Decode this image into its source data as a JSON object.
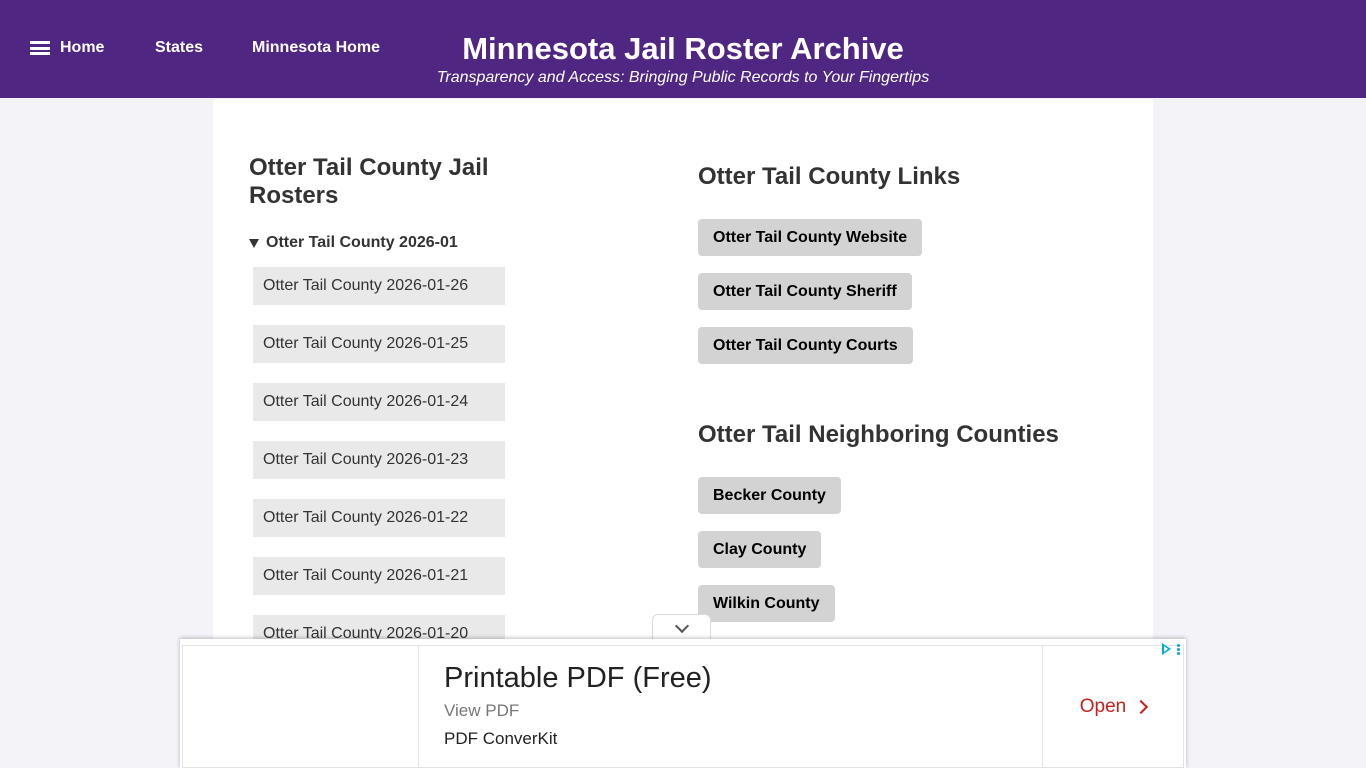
{
  "nav": {
    "home_label": "Home",
    "states_label": "States",
    "state_home_label": "Minnesota Home"
  },
  "header": {
    "title": "Minnesota Jail Roster Archive",
    "subtitle": "Transparency and Access: Bringing Public Records to Your Fingertips"
  },
  "rosters": {
    "title": "Otter Tail County Jail Rosters",
    "group_label": "Otter Tail County 2026-01",
    "items": [
      "Otter Tail County 2026-01-26",
      "Otter Tail County 2026-01-25",
      "Otter Tail County 2026-01-24",
      "Otter Tail County 2026-01-23",
      "Otter Tail County 2026-01-22",
      "Otter Tail County 2026-01-21",
      "Otter Tail County 2026-01-20"
    ]
  },
  "links": {
    "title": "Otter Tail County Links",
    "items": [
      "Otter Tail County Website",
      "Otter Tail County Sheriff",
      "Otter Tail County Courts"
    ]
  },
  "neighbors": {
    "title": "Otter Tail Neighboring Counties",
    "items": [
      "Becker County",
      "Clay County",
      "Wilkin County"
    ]
  },
  "ad": {
    "headline": "Printable PDF (Free)",
    "sub": "View PDF",
    "brand": "PDF ConverKit",
    "cta": "Open"
  },
  "colors": {
    "header_bg": "#502683",
    "button_bg": "#d3d3d3",
    "list_item_bg": "#e9e9e9",
    "cta": "#c5221f",
    "ad_choices": "#00aecd"
  }
}
